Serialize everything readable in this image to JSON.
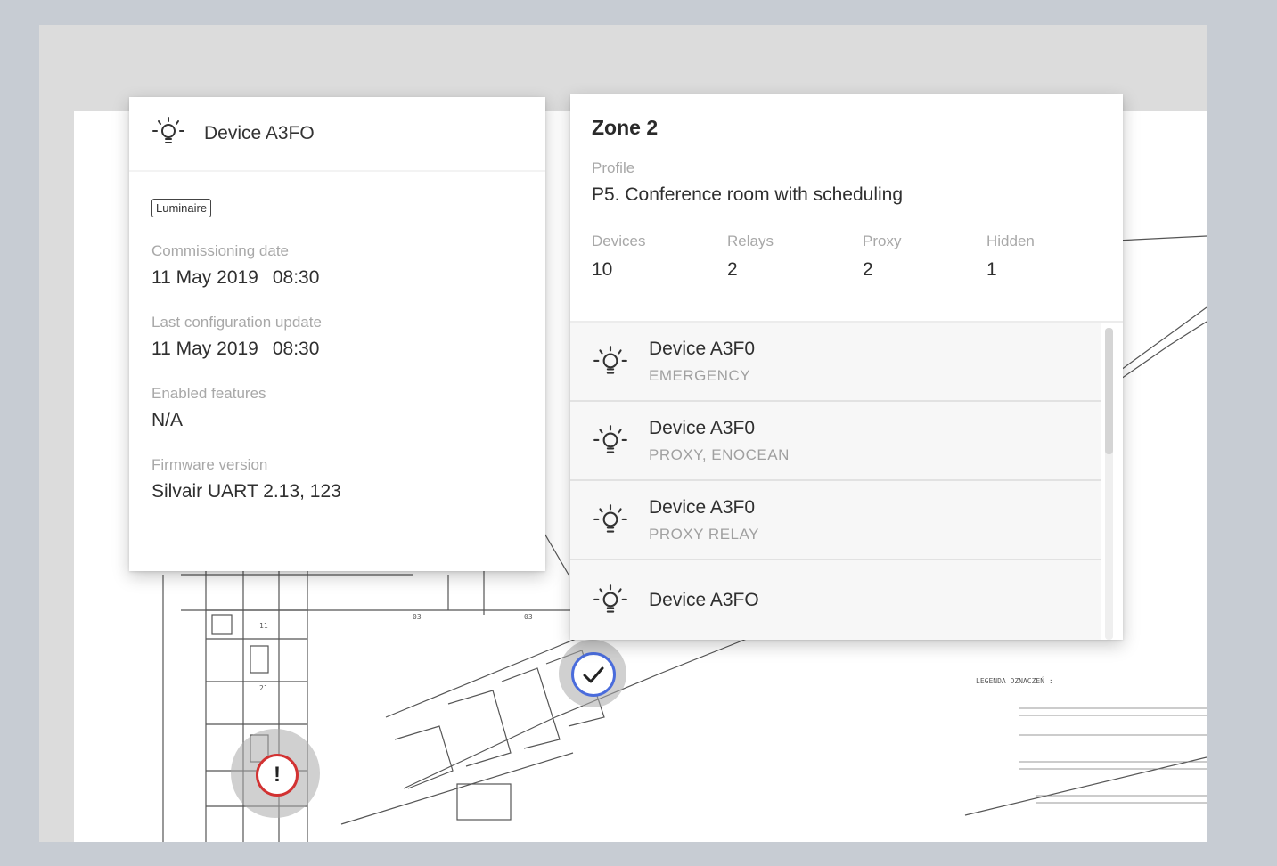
{
  "device_card": {
    "title": "Device A3FO",
    "icon": "bulb-icon",
    "tag": "Luminaire",
    "fields": [
      {
        "label": "Commissioning date",
        "date": "11 May 2019",
        "time": "08:30"
      },
      {
        "label": "Last configuration update",
        "date": "11 May 2019",
        "time": "08:30"
      },
      {
        "label": "Enabled features",
        "value": "N/A"
      },
      {
        "label": "Firmware version",
        "value": "Silvair UART 2.13, 123"
      }
    ]
  },
  "zone_card": {
    "title": "Zone 2",
    "profile_label": "Profile",
    "profile_value": "P5. Conference room with scheduling",
    "stats": [
      {
        "label": "Devices",
        "value": "10"
      },
      {
        "label": "Relays",
        "value": "2"
      },
      {
        "label": "Proxy",
        "value": "2"
      },
      {
        "label": "Hidden",
        "value": "1"
      }
    ],
    "devices": [
      {
        "name": "Device A3F0",
        "sub": "EMERGENCY",
        "icon": "bulb-icon"
      },
      {
        "name": "Device A3F0",
        "sub": "PROXY, ENOCEAN",
        "icon": "bulb-icon"
      },
      {
        "name": "Device A3F0",
        "sub": "PROXY  RELAY",
        "icon": "bulb-icon"
      },
      {
        "name": "Device A3FO",
        "sub": "",
        "icon": "bulb-icon"
      }
    ]
  },
  "map_pins": {
    "ok_pin": "check-icon",
    "alert_pin": {
      "icon": "alert-icon",
      "symbol": "!"
    }
  },
  "legend": {
    "title": "LEGENDA OZNACZEŃ :"
  },
  "colors": {
    "page_bg": "#c7ccd3",
    "frame_bg": "#dcdcdc",
    "check_ring": "#4a6cdc",
    "alert_ring": "#d23232"
  }
}
